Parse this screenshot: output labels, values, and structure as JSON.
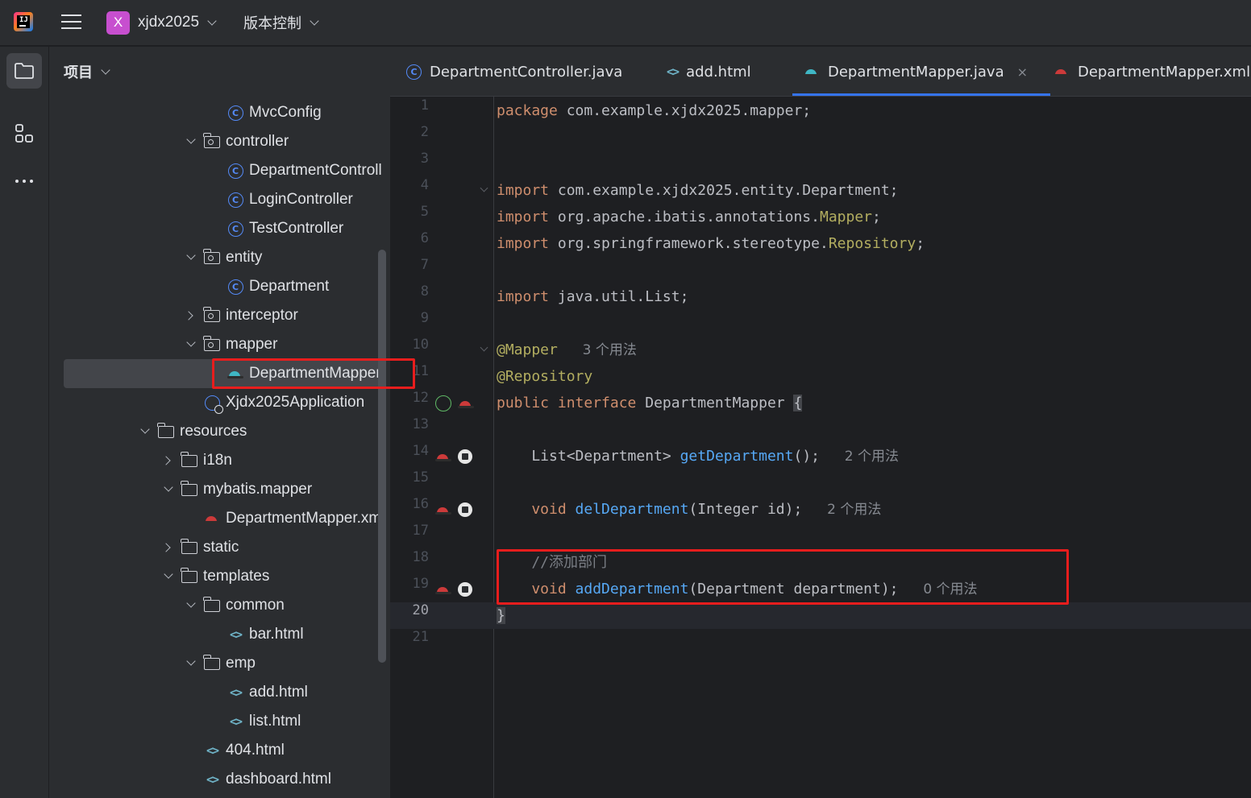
{
  "titlebar": {
    "project_badge": "X",
    "project_name": "xjdx2025",
    "vcs_label": "版本控制"
  },
  "activity_bar": {
    "icons": [
      "folder-icon",
      "structure-icon",
      "more-icon"
    ]
  },
  "project_panel": {
    "title": "项目",
    "tree": [
      {
        "label": "MvcConfig",
        "icon": "class-icon",
        "indent": 3,
        "arrow": ""
      },
      {
        "label": "controller",
        "icon": "package-icon",
        "indent": 2,
        "arrow": "down"
      },
      {
        "label": "DepartmentControll",
        "icon": "class-icon",
        "indent": 3,
        "arrow": ""
      },
      {
        "label": "LoginController",
        "icon": "class-icon",
        "indent": 3,
        "arrow": ""
      },
      {
        "label": "TestController",
        "icon": "class-icon",
        "indent": 3,
        "arrow": ""
      },
      {
        "label": "entity",
        "icon": "package-icon",
        "indent": 2,
        "arrow": "down"
      },
      {
        "label": "Department",
        "icon": "class-icon",
        "indent": 3,
        "arrow": ""
      },
      {
        "label": "interceptor",
        "icon": "package-icon",
        "indent": 2,
        "arrow": "right"
      },
      {
        "label": "mapper",
        "icon": "package-icon",
        "indent": 2,
        "arrow": "down"
      },
      {
        "label": "DepartmentMapper",
        "icon": "mybatis-mapper-icon",
        "indent": 3,
        "arrow": "",
        "selected": true
      },
      {
        "label": "Xjdx2025Application",
        "icon": "spring-app-icon",
        "indent": 2,
        "arrow": ""
      },
      {
        "label": "resources",
        "icon": "resources-folder-icon",
        "indent": 0,
        "arrow": "down"
      },
      {
        "label": "i18n",
        "icon": "folder-icon",
        "indent": 1,
        "arrow": "right"
      },
      {
        "label": "mybatis.mapper",
        "icon": "folder-icon",
        "indent": 1,
        "arrow": "down"
      },
      {
        "label": "DepartmentMapper.xm",
        "icon": "mybatis-xml-icon",
        "indent": 2,
        "arrow": ""
      },
      {
        "label": "static",
        "icon": "folder-icon",
        "indent": 1,
        "arrow": "right"
      },
      {
        "label": "templates",
        "icon": "folder-icon",
        "indent": 1,
        "arrow": "down"
      },
      {
        "label": "common",
        "icon": "folder-icon",
        "indent": 2,
        "arrow": "down"
      },
      {
        "label": "bar.html",
        "icon": "html-icon",
        "indent": 3,
        "arrow": ""
      },
      {
        "label": "emp",
        "icon": "folder-icon",
        "indent": 2,
        "arrow": "down"
      },
      {
        "label": "add.html",
        "icon": "html-icon",
        "indent": 3,
        "arrow": ""
      },
      {
        "label": "list.html",
        "icon": "html-icon",
        "indent": 3,
        "arrow": ""
      },
      {
        "label": "404.html",
        "icon": "html-icon",
        "indent": 2,
        "arrow": ""
      },
      {
        "label": "dashboard.html",
        "icon": "html-icon",
        "indent": 2,
        "arrow": ""
      }
    ]
  },
  "tabs": [
    {
      "label": "DepartmentController.java",
      "icon": "class-icon",
      "active": false
    },
    {
      "label": "add.html",
      "icon": "html-icon",
      "active": false
    },
    {
      "label": "DepartmentMapper.java",
      "icon": "mybatis-mapper-icon",
      "active": true,
      "close": "×"
    },
    {
      "label": "DepartmentMapper.xml",
      "icon": "mybatis-xml-icon",
      "active": false
    }
  ],
  "editor": {
    "current_line": 20,
    "lines": [
      {
        "n": "1",
        "tokens": [
          [
            "kw",
            "package"
          ],
          [
            "",
            "com.example.xjdx2025.mapper;"
          ]
        ]
      },
      {
        "n": "2",
        "tokens": []
      },
      {
        "n": "3",
        "tokens": []
      },
      {
        "n": "4",
        "fold": true,
        "tokens": [
          [
            "kw",
            "import"
          ],
          [
            "",
            "com.example.xjdx2025.entity.Department;"
          ]
        ]
      },
      {
        "n": "5",
        "tokens": [
          [
            "kw",
            "import"
          ],
          [
            "",
            "org.apache.ibatis.annotations."
          ],
          [
            "ann",
            "Mapper"
          ],
          [
            "",
            ";"
          ]
        ]
      },
      {
        "n": "6",
        "tokens": [
          [
            "kw",
            "import"
          ],
          [
            "",
            "org.springframework.stereotype."
          ],
          [
            "ann",
            "Repository"
          ],
          [
            "",
            ";"
          ]
        ]
      },
      {
        "n": "7",
        "tokens": []
      },
      {
        "n": "8",
        "tokens": [
          [
            "kw",
            "import"
          ],
          [
            "",
            "java.util.List;"
          ]
        ]
      },
      {
        "n": "9",
        "tokens": []
      },
      {
        "n": "10",
        "fold": true,
        "tokens": [
          [
            "ann",
            "@Mapper"
          ]
        ],
        "hint": "3 个用法"
      },
      {
        "n": "11",
        "tokens": [
          [
            "ann",
            "@Repository"
          ]
        ]
      },
      {
        "n": "12",
        "gutter": [
          "spring-bean-icon",
          "mybatis-icon"
        ],
        "tokens": [
          [
            "kw",
            "public interface"
          ],
          [
            "",
            "DepartmentMapper"
          ],
          [
            "brace",
            "{"
          ]
        ]
      },
      {
        "n": "13",
        "tokens": []
      },
      {
        "n": "14",
        "gutter": [
          "mybatis-icon",
          "implemented-icon"
        ],
        "tokens": [
          [
            "",
            "    List<Department>"
          ],
          [
            "fn",
            "getDepartment"
          ],
          [
            "",
            "();"
          ]
        ],
        "hint": "2 个用法"
      },
      {
        "n": "15",
        "tokens": []
      },
      {
        "n": "16",
        "gutter": [
          "mybatis-icon",
          "implemented-icon"
        ],
        "tokens": [
          [
            "kw",
            "    void"
          ],
          [
            "fn",
            "delDepartment"
          ],
          [
            "",
            "(Integer id);"
          ]
        ],
        "hint": "2 个用法"
      },
      {
        "n": "17",
        "tokens": []
      },
      {
        "n": "18",
        "tokens": [
          [
            "cmt",
            "    //添加部门"
          ]
        ]
      },
      {
        "n": "19",
        "gutter": [
          "mybatis-icon",
          "implemented-icon"
        ],
        "tokens": [
          [
            "kw",
            "    void"
          ],
          [
            "fn",
            "addDepartment"
          ],
          [
            "",
            "(Department department);"
          ]
        ],
        "hint": "0 个用法"
      },
      {
        "n": "20",
        "tokens": [
          [
            "brace",
            "}"
          ]
        ]
      },
      {
        "n": "21",
        "tokens": []
      }
    ]
  },
  "colors": {
    "keyword": "#cf8e6d",
    "annotation": "#b3ae60",
    "function": "#56a8f5",
    "highlight_box": "#e81d1d"
  }
}
